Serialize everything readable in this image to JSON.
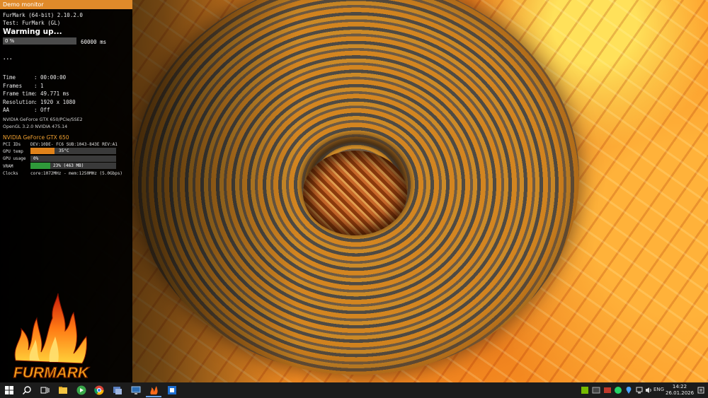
{
  "window": {
    "title": "Demo monitor"
  },
  "app": {
    "name_version": "FurMark (64-bit) 2.10.2.0",
    "test": "Test: FurMark (GL)",
    "status": "Warming up..."
  },
  "progress": {
    "label": "0 %",
    "value": 0,
    "duration": "60000 ms"
  },
  "ellipsis": "...",
  "stats": [
    {
      "key": "Time",
      "value": ": 00:00:00"
    },
    {
      "key": "Frames",
      "value": ": 1"
    },
    {
      "key": "Frame time",
      "value": ": 49.771 ms"
    },
    {
      "key": "Resolution",
      "value": ": 1920 x 1080"
    },
    {
      "key": "AA",
      "value": ": Off"
    }
  ],
  "renderer": {
    "gpu_line": "NVIDIA GeForce GTX 650/PCIe/SSE2",
    "opengl": "OpenGL 3.2.0 NVIDIA 475.14"
  },
  "gpu": {
    "name": "NVIDIA GeForce GTX 650",
    "pci_label": "PCI IDs",
    "pci_value": "DEV:10DE- FC6 SUB:1043-843E REV:A1",
    "temp_label": "GPU temp",
    "temp_value": "35°C",
    "temp_fill": 0.28,
    "temp_color": "#e0821a",
    "usage_label": "GPU usage",
    "usage_value": "0%",
    "usage_fill": 0.0,
    "vram_label": "VRAM",
    "vram_value": "23% (463 MB)",
    "vram_fill": 0.23,
    "vram_color": "#2f9a3a",
    "clocks_label": "Clocks",
    "clocks_value": "core:1072MHz - mem:1250MHz (5.0Gbps)"
  },
  "logo": {
    "text": "FURMARK"
  },
  "taskbar": {
    "icons": [
      "windows-start-icon",
      "search-icon",
      "task-view-icon",
      "file-explorer-icon",
      "green-app-icon",
      "chrome-icon",
      "installer-icon",
      "display-icon",
      "furmark-icon",
      "blue-app-icon"
    ],
    "tray": {
      "lang": "ENG",
      "time": "14:22",
      "date": "26.01.2026"
    }
  },
  "colors": {
    "accent": "#e08a2a",
    "gpu_name": "#f0a030"
  }
}
